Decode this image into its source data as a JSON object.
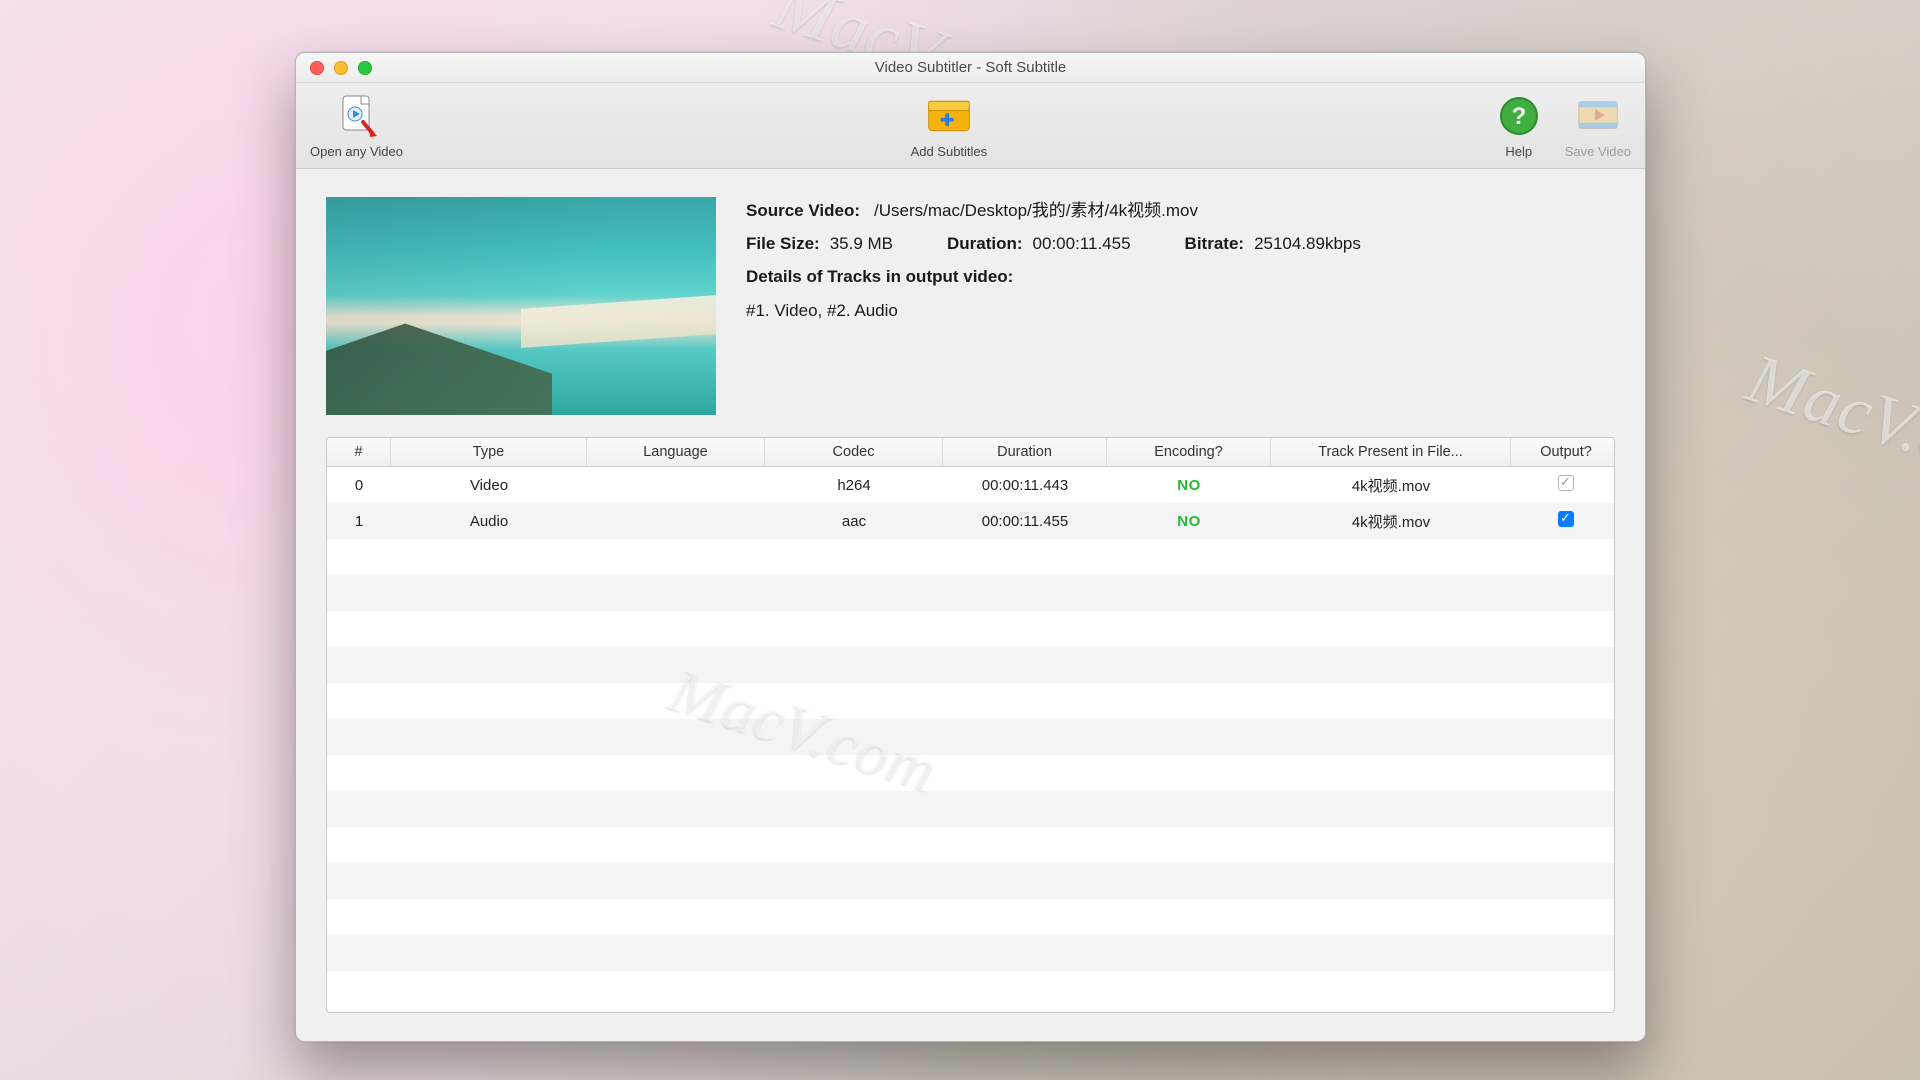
{
  "window": {
    "title": "Video Subtitler - Soft Subtitle"
  },
  "toolbar": {
    "open_label": "Open any Video",
    "add_label": "Add Subtitles",
    "help_label": "Help",
    "save_label": "Save Video"
  },
  "source": {
    "label": "Source Video:",
    "path": "/Users/mac/Desktop/我的/素材/4k视频.mov",
    "size_label": "File Size:",
    "size_value": "35.9 MB",
    "duration_label": "Duration:",
    "duration_value": "00:00:11.455",
    "bitrate_label": "Bitrate:",
    "bitrate_value": "25104.89kbps",
    "details_label": "Details of Tracks in output video:",
    "details_value": "#1. Video, #2. Audio"
  },
  "table": {
    "headers": {
      "idx": "#",
      "type": "Type",
      "language": "Language",
      "codec": "Codec",
      "duration": "Duration",
      "encoding": "Encoding?",
      "present": "Track Present in File...",
      "output": "Output?"
    },
    "rows": [
      {
        "idx": "0",
        "type": "Video",
        "language": "",
        "codec": "h264",
        "duration": "00:00:11.443",
        "encoding": "NO",
        "present": "4k视频.mov",
        "output_checked": false
      },
      {
        "idx": "1",
        "type": "Audio",
        "language": "",
        "codec": "aac",
        "duration": "00:00:11.455",
        "encoding": "NO",
        "present": "4k视频.mov",
        "output_checked": true
      }
    ]
  },
  "watermarks": {
    "a": "MacV.com",
    "b": "MacV.c",
    "c": "MacV.com"
  }
}
